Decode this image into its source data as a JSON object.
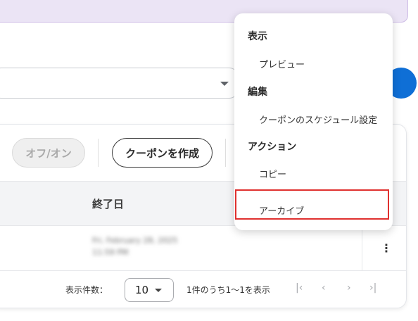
{
  "toolbar": {
    "toggle_label": "オフ/オン",
    "create_label": "クーポンを作成"
  },
  "table": {
    "columns": [
      "終了日"
    ],
    "rows": [
      {
        "end_date": "Fri, February 28, 2025 11:59 PM"
      }
    ],
    "row_action_icon": "more-vertical-icon"
  },
  "pagination": {
    "per_page_label": "表示件数：",
    "per_page_value": "10",
    "range_text": "1件のうち1〜1を表示",
    "icons": [
      "first-page-icon",
      "prev-page-icon",
      "next-page-icon",
      "last-page-icon"
    ]
  },
  "menu": {
    "sections": [
      {
        "heading": "表示",
        "items": [
          "プレビュー"
        ]
      },
      {
        "heading": "編集",
        "items": [
          "クーポンのスケジュール設定"
        ]
      },
      {
        "heading": "アクション",
        "items": [
          "コピー",
          "アーカイブ"
        ]
      }
    ],
    "highlighted_item": "アーカイブ",
    "highlight_color": "#e0312f"
  },
  "colors": {
    "banner_bg": "#ebe4f5",
    "primary_blue": "#0f6fd6"
  }
}
